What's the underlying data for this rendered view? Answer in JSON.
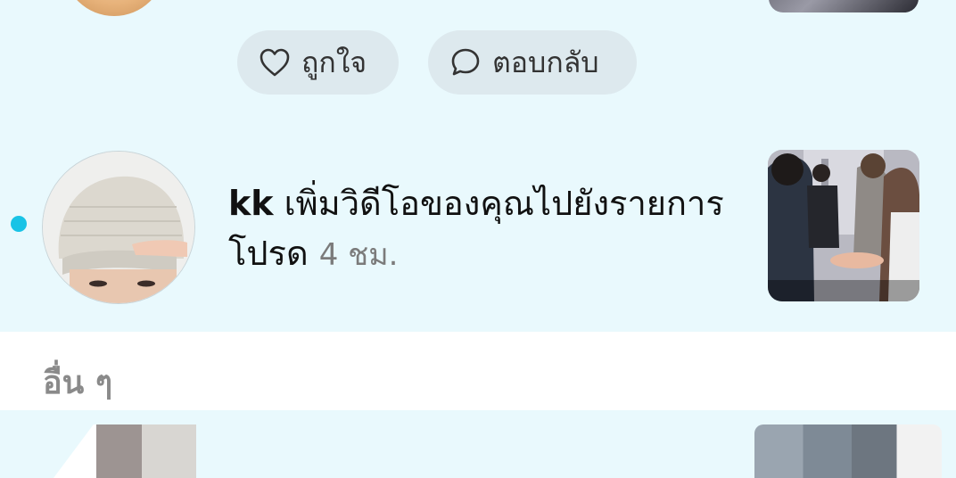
{
  "previous_item": {
    "actions": {
      "like_label": "ถูกใจ",
      "reply_label": "ตอบกลับ"
    }
  },
  "notification": {
    "username": "kk",
    "message": " เพิ่มวิดีโอของคุณไปยังรายการโปรด ",
    "time": "4 ชม.",
    "unread_color": "#19c3e6"
  },
  "others_section": {
    "title": "อื่น ๆ"
  },
  "colors": {
    "unread_background": "#e9f9fd",
    "section_background": "#ffffff",
    "pill_background": "#dde9ee",
    "time_text": "#7b7b7b"
  }
}
